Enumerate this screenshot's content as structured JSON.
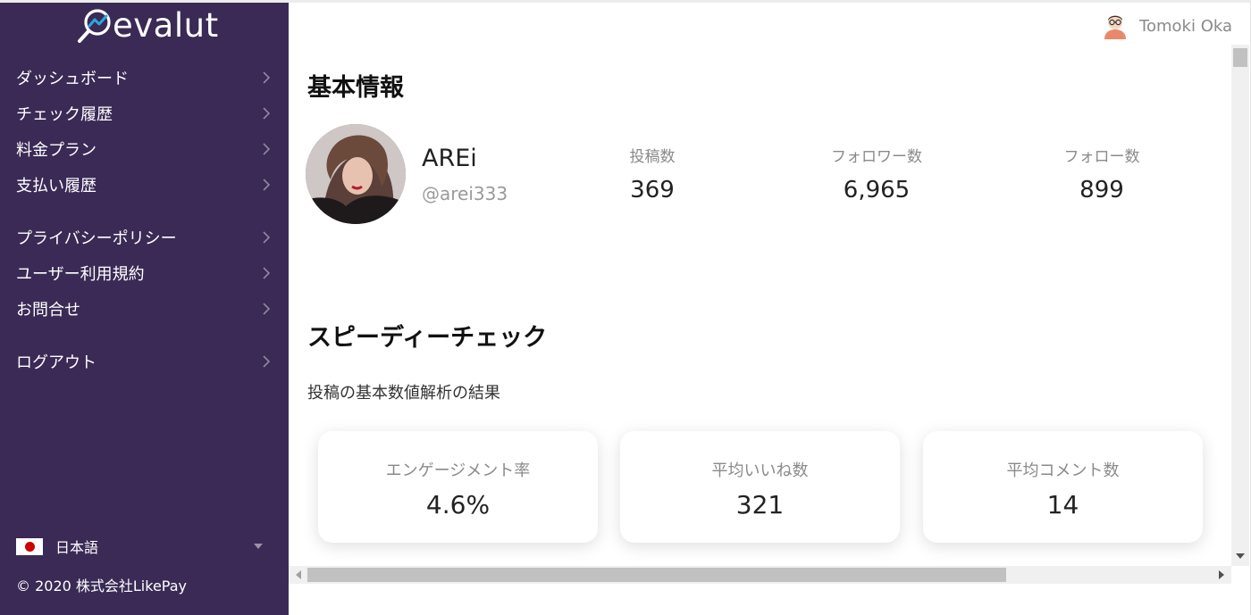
{
  "brand": {
    "name": "evalut",
    "logo_icon": "magnifier-chart-icon"
  },
  "sidebar": {
    "items": [
      {
        "label": "ダッシュボード"
      },
      {
        "label": "チェック履歴"
      },
      {
        "label": "料金プラン"
      },
      {
        "label": "支払い履歴"
      },
      {
        "label": "プライバシーポリシー"
      },
      {
        "label": "ユーザー利用規約"
      },
      {
        "label": "お問合せ"
      },
      {
        "label": "ログアウト"
      }
    ],
    "language": {
      "label": "日本語",
      "flag": "japan-flag-icon"
    },
    "copyright": "© 2020 株式会社LikePay"
  },
  "header": {
    "user_name": "Tomoki Oka",
    "avatar_icon": "user-avatar-icon"
  },
  "profile": {
    "section_title": "基本情報",
    "name": "AREi",
    "handle": "@arei333",
    "stats": [
      {
        "label": "投稿数",
        "value": "369"
      },
      {
        "label": "フォロワー数",
        "value": "6,965"
      },
      {
        "label": "フォロー数",
        "value": "899"
      }
    ]
  },
  "speedy_check": {
    "section_title": "スピーディーチェック",
    "subtitle": "投稿の基本数値解析の結果",
    "cards": [
      {
        "label": "エンゲージメント率",
        "value": "4.6%"
      },
      {
        "label": "平均いいね数",
        "value": "321"
      },
      {
        "label": "平均コメント数",
        "value": "14"
      }
    ]
  },
  "colors": {
    "sidebar_bg": "#3a2a55",
    "text_dark": "#222222",
    "text_muted": "#8a8a8a"
  }
}
